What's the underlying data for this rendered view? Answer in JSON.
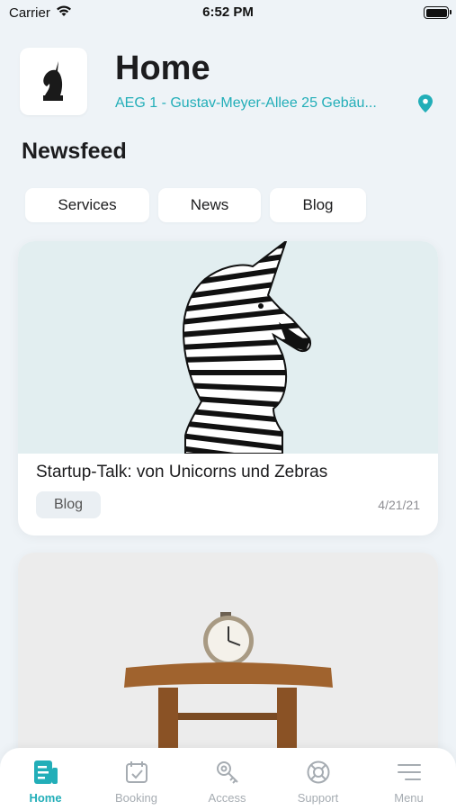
{
  "status_bar": {
    "carrier": "Carrier",
    "time": "6:52 PM"
  },
  "header": {
    "title": "Home",
    "location": "AEG 1 - Gustav-Meyer-Allee 25 Gebäu..."
  },
  "newsfeed": {
    "title": "Newsfeed",
    "filters": [
      "Services",
      "News",
      "Blog"
    ]
  },
  "cards": [
    {
      "title": "Startup-Talk: von Unicorns und Zebras",
      "tag": "Blog",
      "date": "4/21/21"
    },
    {
      "title": "",
      "tag": "",
      "date": ""
    }
  ],
  "tab_bar": {
    "tabs": [
      {
        "label": "Home",
        "icon": "news-icon",
        "active": true
      },
      {
        "label": "Booking",
        "icon": "calendar-check-icon",
        "active": false
      },
      {
        "label": "Access",
        "icon": "key-icon",
        "active": false
      },
      {
        "label": "Support",
        "icon": "lifebuoy-icon",
        "active": false
      },
      {
        "label": "Menu",
        "icon": "menu-icon",
        "active": false
      }
    ]
  },
  "colors": {
    "accent": "#22aeb8",
    "background": "#eef3f7",
    "inactive_tab": "#a6acb2"
  }
}
